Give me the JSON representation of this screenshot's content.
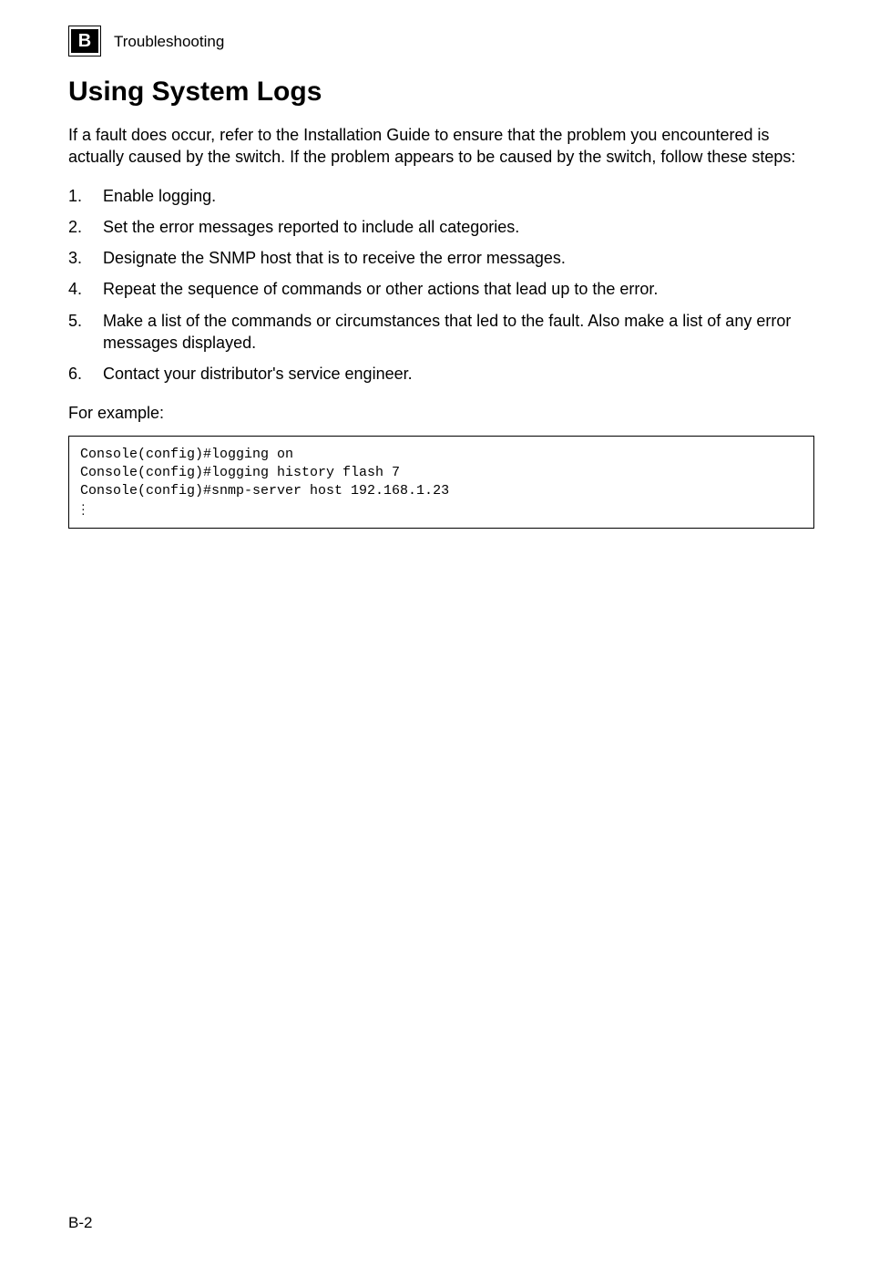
{
  "header": {
    "appendix_letter": "B",
    "breadcrumb": "Troubleshooting"
  },
  "title": "Using System Logs",
  "intro": "If a fault does occur, refer to the Installation Guide to ensure that the problem you encountered is actually caused by the switch. If the problem appears to be caused by the switch, follow these steps:",
  "steps": [
    "Enable logging.",
    "Set the error messages reported to include all categories.",
    "Designate the SNMP host that is to receive the error messages.",
    "Repeat the sequence of commands or other actions that lead up to the error.",
    "Make a list of the commands or circumstances that led to the fault. Also make a list of any error messages displayed.",
    "Contact your distributor's service engineer."
  ],
  "example_label": "For example:",
  "code": {
    "line1": "Console(config)#logging on",
    "line2": "Console(config)#logging history flash 7",
    "line3": "Console(config)#snmp-server host 192.168.1.23"
  },
  "page_number": "B-2"
}
